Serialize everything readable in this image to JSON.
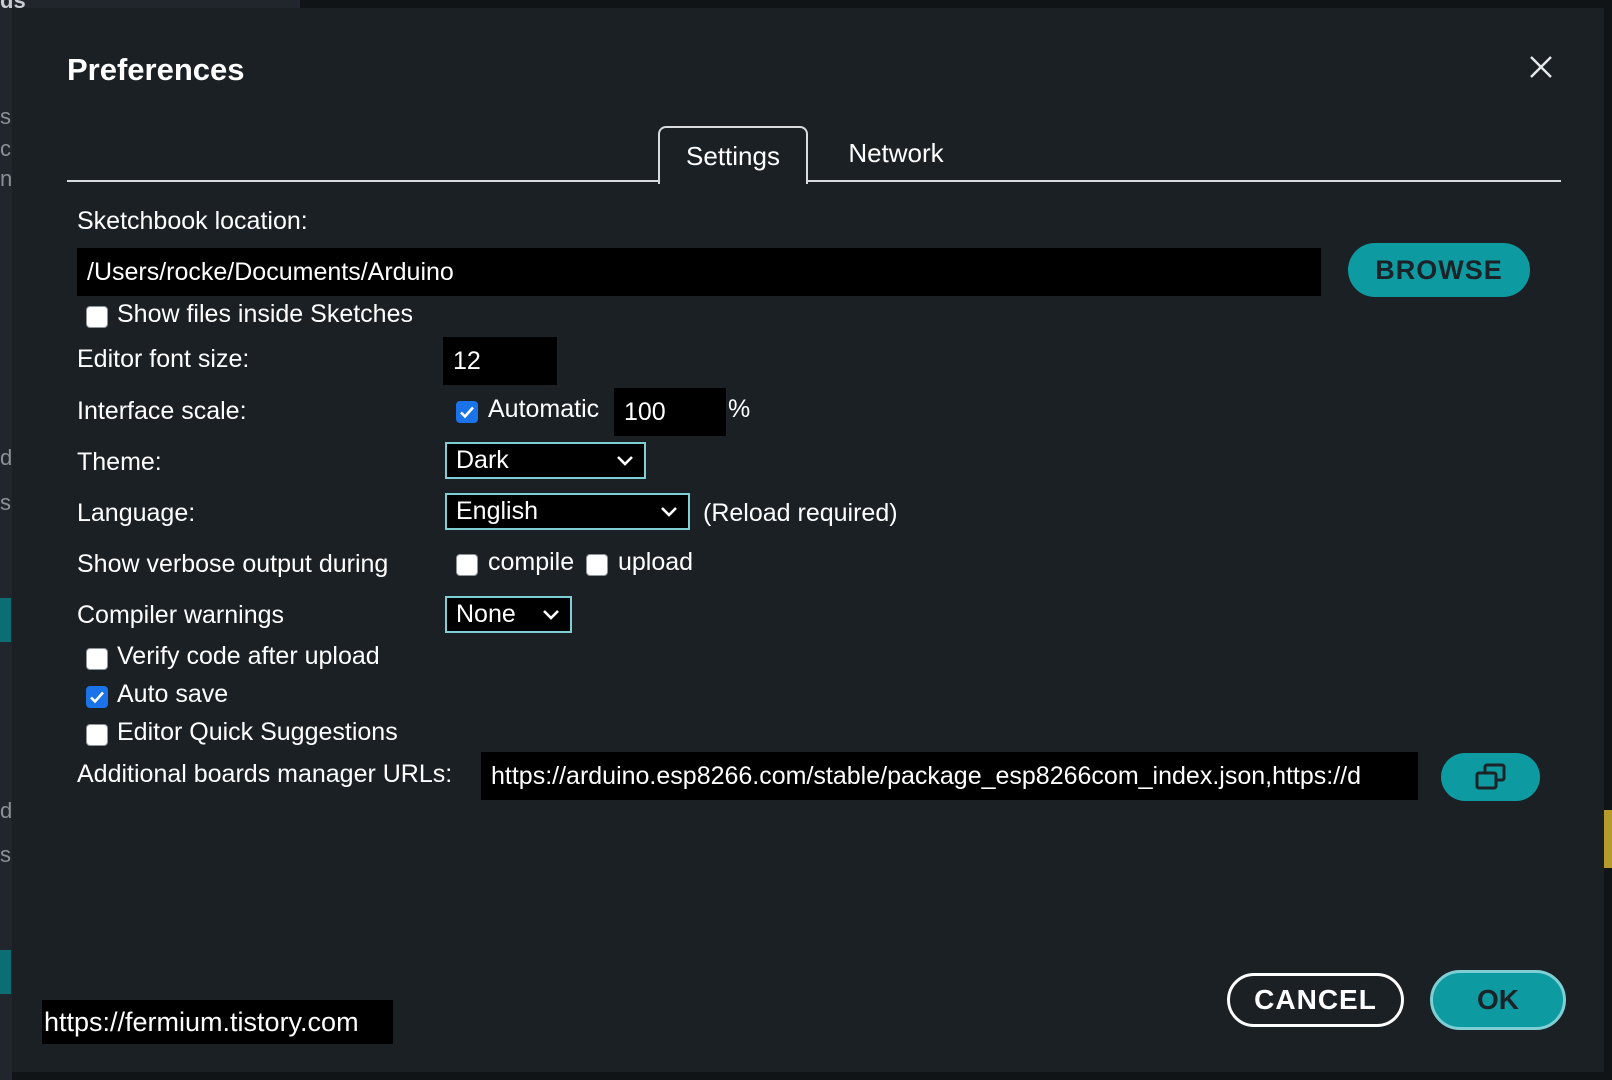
{
  "dialog": {
    "title": "Preferences",
    "tabs": {
      "settings": "Settings",
      "network": "Network"
    }
  },
  "sketchbook": {
    "label": "Sketchbook location:",
    "value": "/Users/rocke/Documents/Arduino",
    "browse_label": "BROWSE",
    "show_files_label": "Show files inside Sketches",
    "show_files_checked": false
  },
  "font_size": {
    "label": "Editor font size:",
    "value": "12"
  },
  "interface_scale": {
    "label": "Interface scale:",
    "automatic_label": "Automatic",
    "automatic_checked": true,
    "value": "100",
    "unit": "%"
  },
  "theme": {
    "label": "Theme:",
    "selected": "Dark"
  },
  "language": {
    "label": "Language:",
    "selected": "English",
    "note": "(Reload required)"
  },
  "verbose": {
    "label": "Show verbose output during",
    "compile_label": "compile",
    "compile_checked": false,
    "upload_label": "upload",
    "upload_checked": false
  },
  "compiler_warnings": {
    "label": "Compiler warnings",
    "selected": "None"
  },
  "options": {
    "verify_label": "Verify code after upload",
    "verify_checked": false,
    "autosave_label": "Auto save",
    "autosave_checked": true,
    "quick_suggestions_label": "Editor Quick Suggestions",
    "quick_suggestions_checked": false
  },
  "boards_urls": {
    "label": "Additional boards manager URLs:",
    "value": "https://arduino.esp8266.com/stable/package_esp8266com_index.json,https://d",
    "open_icon": "open-window-icon"
  },
  "footer": {
    "cancel_label": "CANCEL",
    "ok_label": "OK"
  },
  "watermark": "https://fermium.tistory.com",
  "background_fragments": [
    "ds",
    "s",
    "c",
    "n,",
    "d",
    "s",
    "d",
    "s"
  ],
  "colors": {
    "accent": "#0d9aa0",
    "dialog_bg": "#1a2024",
    "input_bg": "#000000",
    "select_border": "#7ecfd4",
    "checkbox_checked": "#1a73e8"
  }
}
